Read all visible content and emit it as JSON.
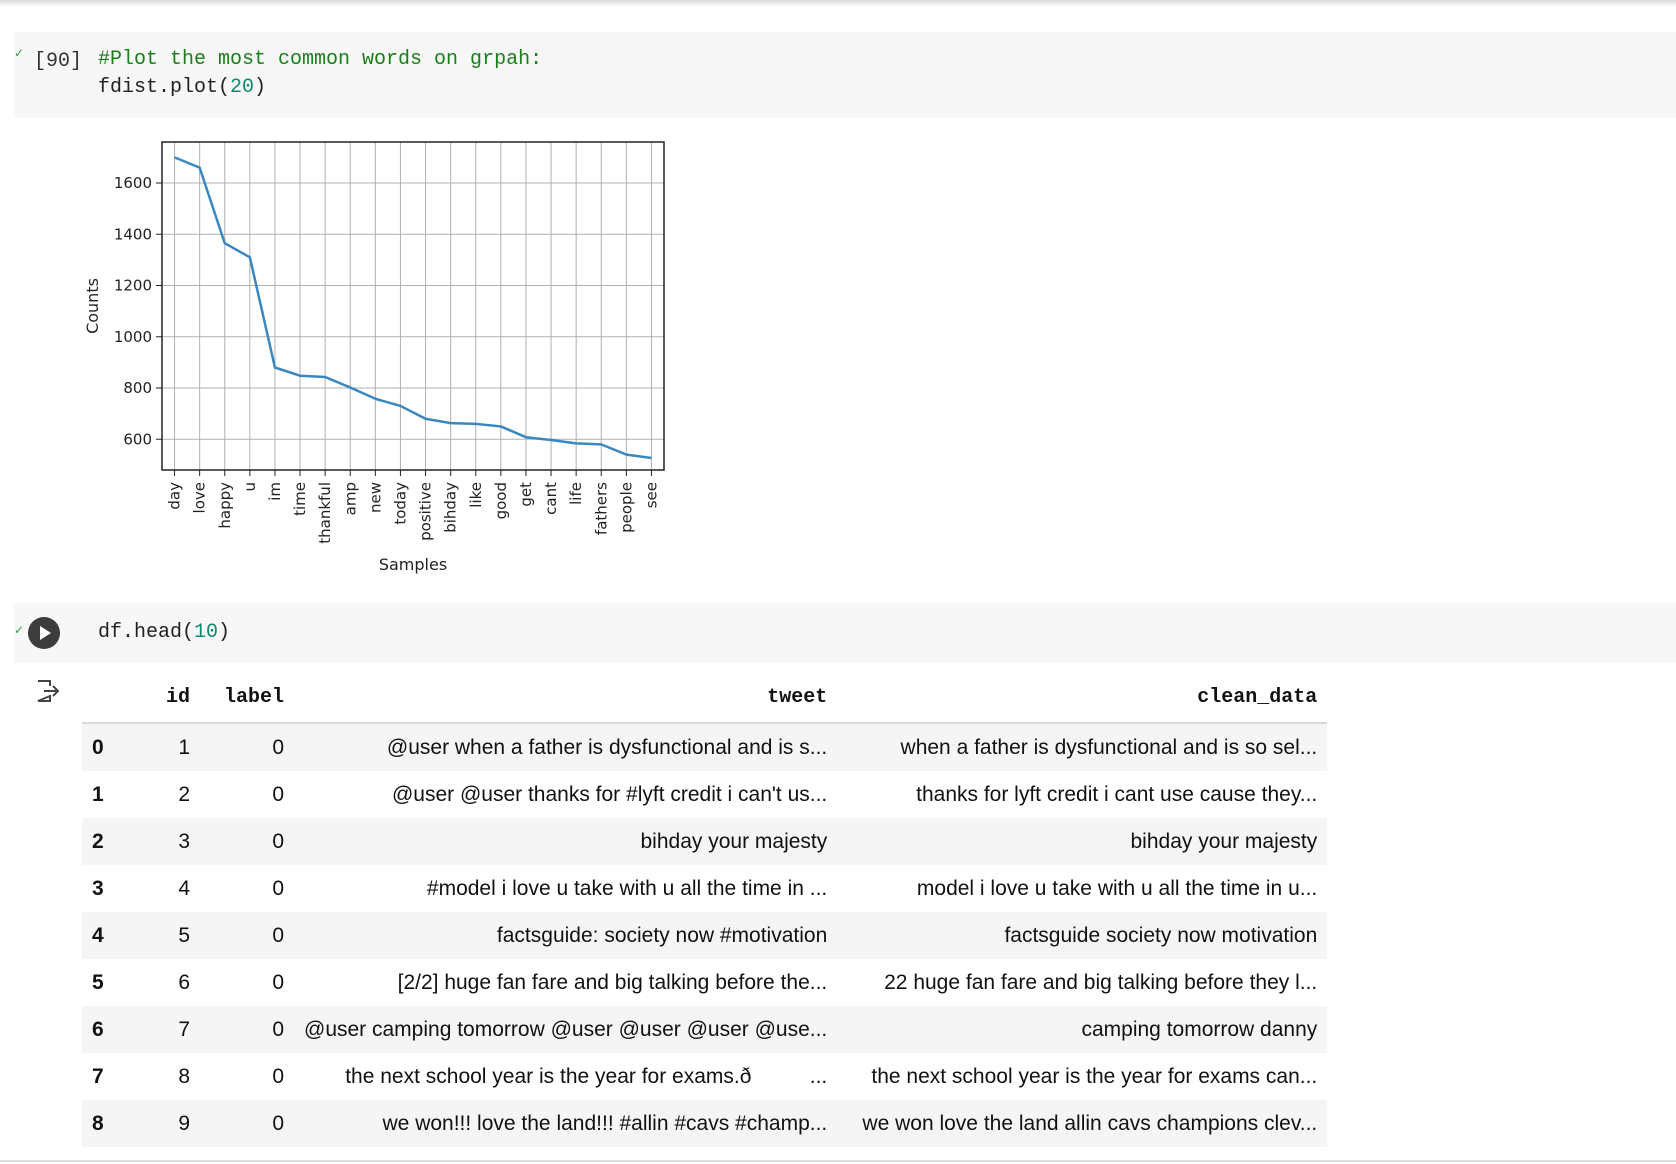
{
  "cell1": {
    "exec_count": "[90]",
    "comment": "#Plot the most common words on grpah:",
    "code_fn": "fdist.plot(",
    "code_arg": "20",
    "code_end": ")"
  },
  "cell2": {
    "code_fn": "df.head(",
    "code_arg": "10",
    "code_end": ")"
  },
  "chart_data": {
    "type": "line",
    "categories": [
      "day",
      "love",
      "happy",
      "u",
      "im",
      "time",
      "thankful",
      "amp",
      "new",
      "today",
      "positive",
      "bihday",
      "like",
      "good",
      "get",
      "cant",
      "life",
      "fathers",
      "people",
      "see"
    ],
    "series": [
      {
        "values": [
          1700,
          1660,
          1365,
          1310,
          880,
          848,
          843,
          802,
          758,
          730,
          680,
          663,
          660,
          650,
          608,
          597,
          584,
          580,
          540,
          527
        ]
      }
    ],
    "xlabel": "Samples",
    "ylabel": "Counts",
    "yticks": [
      600,
      800,
      1000,
      1200,
      1400,
      1600
    ],
    "ylim": [
      480,
      1760
    ],
    "grid": true,
    "color": "#3a87c0"
  },
  "table": {
    "columns": [
      "",
      "id",
      "label",
      "tweet",
      "clean_data"
    ],
    "rows": [
      [
        "0",
        "1",
        "0",
        "@user when a father is dysfunctional and is s...",
        "when a father is dysfunctional and is so sel..."
      ],
      [
        "1",
        "2",
        "0",
        "@user @user thanks for #lyft credit i can't us...",
        "thanks for lyft credit i cant use cause they..."
      ],
      [
        "2",
        "3",
        "0",
        "bihday your majesty",
        "bihday your majesty"
      ],
      [
        "3",
        "4",
        "0",
        "#model i love u take with u all the time in ...",
        "model i love u take with u all the time in u..."
      ],
      [
        "4",
        "5",
        "0",
        "factsguide: society now #motivation",
        "factsguide society now motivation"
      ],
      [
        "5",
        "6",
        "0",
        "[2/2] huge fan fare and big talking before the...",
        "22 huge fan fare and big talking before they l..."
      ],
      [
        "6",
        "7",
        "0",
        "@user camping tomorrow @user @user @user @use...",
        "camping tomorrow danny"
      ],
      [
        "7",
        "8",
        "0",
        "the next school year is the year for exams.ð          ...",
        "the next school year is the year for exams can..."
      ],
      [
        "8",
        "9",
        "0",
        "we won!!! love the land!!! #allin #cavs #champ...",
        "we won love the land allin cavs champions clev..."
      ]
    ]
  }
}
